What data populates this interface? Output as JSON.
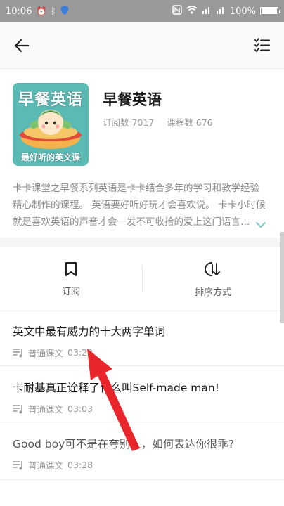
{
  "status": {
    "time": "10:06",
    "battery": "100%",
    "battery_level": 1.0
  },
  "course": {
    "title": "早餐英语",
    "cover_title": "早餐英语",
    "cover_subtitle": "最好听的英文课",
    "subscribers_label": "订阅数 7017",
    "lessons_label": "课程数 676",
    "description": "卡卡课堂之早餐系列英语是卡卡结合多年的学习和教学经验精心制作的课程。 英语要好听好玩才会喜欢说。 卡卡小时候就是喜欢英语的声音才会一发不可收拾的爱上这门语言…"
  },
  "actions": {
    "subscribe_label": "订阅",
    "sort_label": "排序方式"
  },
  "lessons": [
    {
      "title": "英文中最有威力的十大两字单词",
      "type": "普通课文",
      "duration": "03:29"
    },
    {
      "title": "卡耐基真正诠释了什么叫Self-made man!",
      "type": "普通课文",
      "duration": "03:03"
    },
    {
      "title": "Good boy可不是在夸别人，如何表达你很乖?",
      "type": "普通课文",
      "duration": "03:28"
    }
  ],
  "colors": {
    "status_bar": "#9a9a9a",
    "cover_bg": "#5cbab5",
    "annotation_arrow": "#e8262b",
    "expand_chevron": "#7fc8c2"
  }
}
